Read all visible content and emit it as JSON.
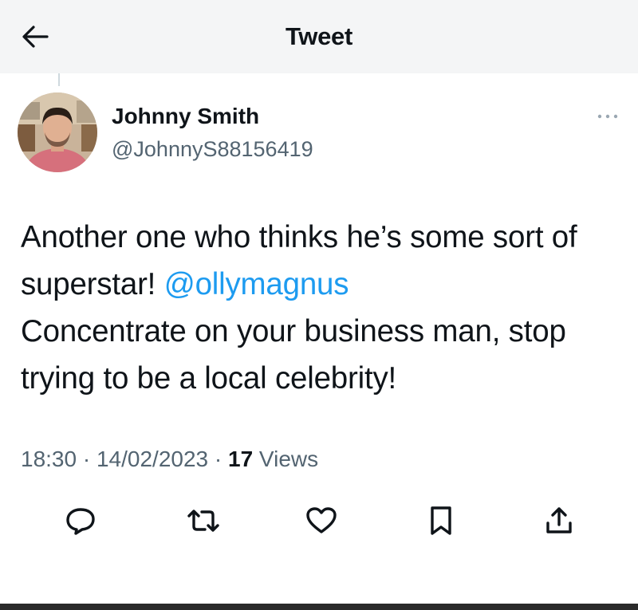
{
  "header": {
    "title": "Tweet",
    "back_icon": "arrow-left-icon"
  },
  "author": {
    "display_name": "Johnny Smith",
    "handle": "@JohnnyS88156419",
    "more_icon": "more-horizontal-icon"
  },
  "tweet": {
    "text_before_mention": "Another one who thinks he’s some sort of superstar! ",
    "mention": "@ollymagnus",
    "text_after_mention": "Concentrate on your business man, stop trying to be a local celebrity!",
    "time": "18:30",
    "separator": " · ",
    "date": "14/02/2023",
    "views_count": "17",
    "views_label": " Views"
  },
  "actions": [
    {
      "name": "reply",
      "icon": "reply-icon"
    },
    {
      "name": "retweet",
      "icon": "retweet-icon"
    },
    {
      "name": "like",
      "icon": "heart-icon"
    },
    {
      "name": "bookmark",
      "icon": "bookmark-icon"
    },
    {
      "name": "share",
      "icon": "share-icon"
    }
  ],
  "colors": {
    "accent": "#1d9bf0",
    "text_primary": "#0f1419",
    "text_secondary": "#536471",
    "header_background": "#f4f5f6"
  }
}
